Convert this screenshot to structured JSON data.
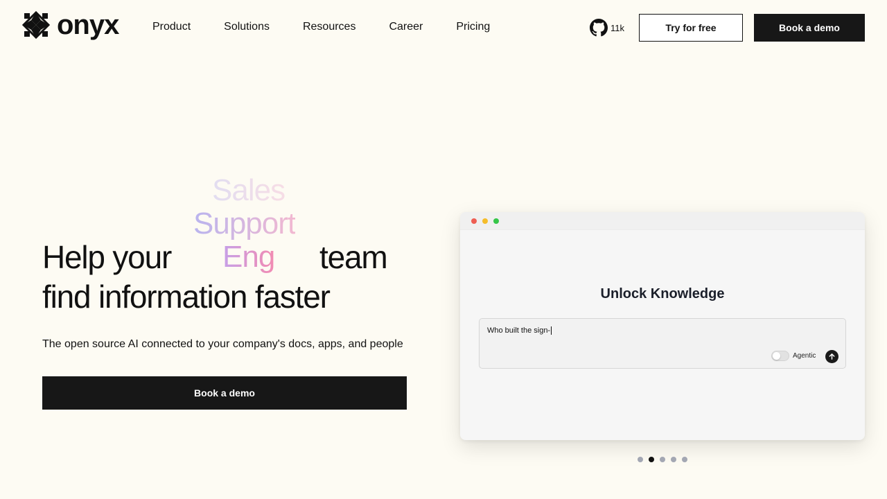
{
  "brand": {
    "name": "onyx",
    "logo_icon": "onyx-logo-icon"
  },
  "nav": {
    "items": [
      {
        "label": "Product"
      },
      {
        "label": "Solutions"
      },
      {
        "label": "Resources"
      },
      {
        "label": "Career"
      },
      {
        "label": "Pricing"
      }
    ]
  },
  "github": {
    "icon": "github-icon",
    "stars": "11k"
  },
  "header_buttons": {
    "try": "Try for free",
    "demo": "Book a demo"
  },
  "hero": {
    "rotating_words": [
      "Sales",
      "Support",
      "Eng"
    ],
    "line1_prefix": "Help your",
    "line1_suffix": "team",
    "line2": "find information faster",
    "subtitle": "The open source AI connected to your company's docs, apps, and people",
    "cta": "Book a demo"
  },
  "demo_window": {
    "title": "Unlock Knowledge",
    "query": "Who built the sign-",
    "toggle_label": "Agentic",
    "toggle_on": false,
    "send_icon": "arrow-up-icon"
  },
  "carousel": {
    "count": 5,
    "active_index": 1
  },
  "colors": {
    "background": "#fdfbf3",
    "primary": "#171717",
    "accent_gradient_start": "#a9a3ee",
    "accent_gradient_end": "#f28bb2"
  }
}
